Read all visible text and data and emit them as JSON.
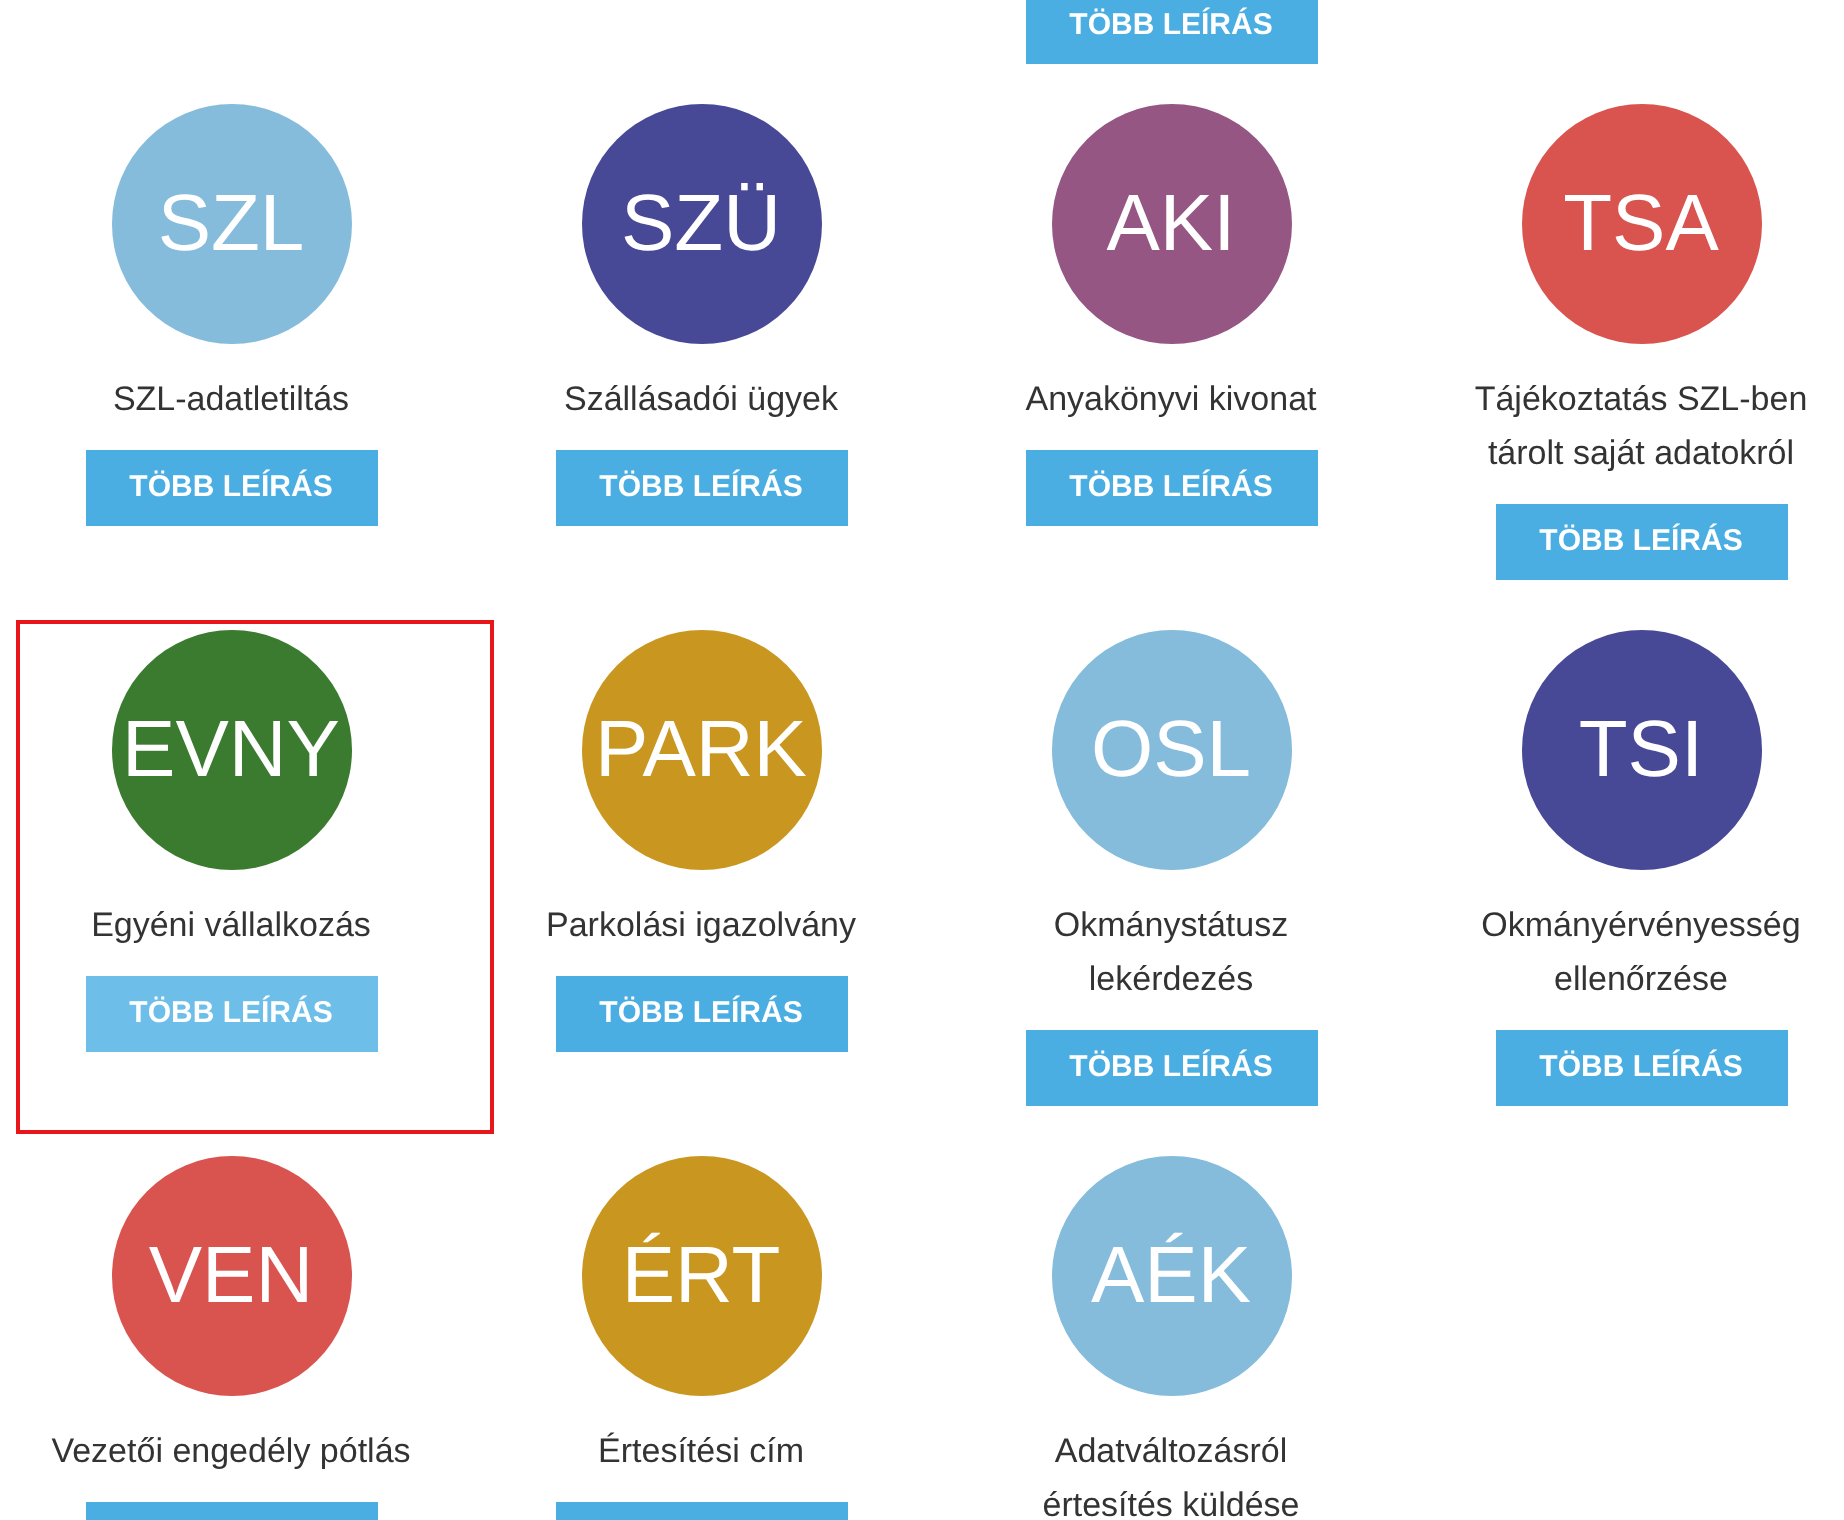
{
  "top_button": {
    "label": "TÖBB LEÍRÁS"
  },
  "services": [
    {
      "abbr": "SZL",
      "color": "#85bbdb",
      "title": [
        "SZL-adatletiltás"
      ],
      "button": {
        "label": "TÖBB LEÍRÁS"
      },
      "highlighted": false
    },
    {
      "abbr": "SZÜ",
      "color": "#474896",
      "title": [
        "Szállásadói ügyek"
      ],
      "button": {
        "label": "TÖBB LEÍRÁS"
      },
      "highlighted": false
    },
    {
      "abbr": "AKI",
      "color": "#955683",
      "title": [
        "Anyakönyvi kivonat"
      ],
      "button": {
        "label": "TÖBB LEÍRÁS"
      },
      "highlighted": false
    },
    {
      "abbr": "TSA",
      "color": "#d9534f",
      "title": [
        "Tájékoztatás SZL-ben",
        "tárolt saját adatokról"
      ],
      "button": {
        "label": "TÖBB LEÍRÁS"
      },
      "highlighted": false
    },
    {
      "abbr": "EVNY",
      "color": "#3b7b2f",
      "title": [
        "Egyéni vállalkozás"
      ],
      "button": {
        "label": "TÖBB LEÍRÁS"
      },
      "highlighted": true
    },
    {
      "abbr": "PARK",
      "color": "#c9971f",
      "title": [
        "Parkolási igazolvány"
      ],
      "button": {
        "label": "TÖBB LEÍRÁS"
      },
      "highlighted": false
    },
    {
      "abbr": "OSL",
      "color": "#85bbdb",
      "title": [
        "Okmánystátusz",
        "lekérdezés"
      ],
      "button": {
        "label": "TÖBB LEÍRÁS"
      },
      "highlighted": false
    },
    {
      "abbr": "TSI",
      "color": "#474896",
      "title": [
        "Okmányérvényesség",
        "ellenőrzése"
      ],
      "button": {
        "label": "TÖBB LEÍRÁS"
      },
      "highlighted": false
    },
    {
      "abbr": "VEN",
      "color": "#d9534f",
      "title": [
        "Vezetői engedély pótlás"
      ],
      "button": {
        "clipped": true
      },
      "highlighted": false
    },
    {
      "abbr": "ÉRT",
      "color": "#c9971f",
      "title": [
        "Értesítési cím"
      ],
      "button": {
        "clipped": true
      },
      "highlighted": false
    },
    {
      "abbr": "AÉK",
      "color": "#85bbdb",
      "title": [
        "Adatváltozásról",
        "értesítés küldése"
      ],
      "highlighted": false
    }
  ]
}
